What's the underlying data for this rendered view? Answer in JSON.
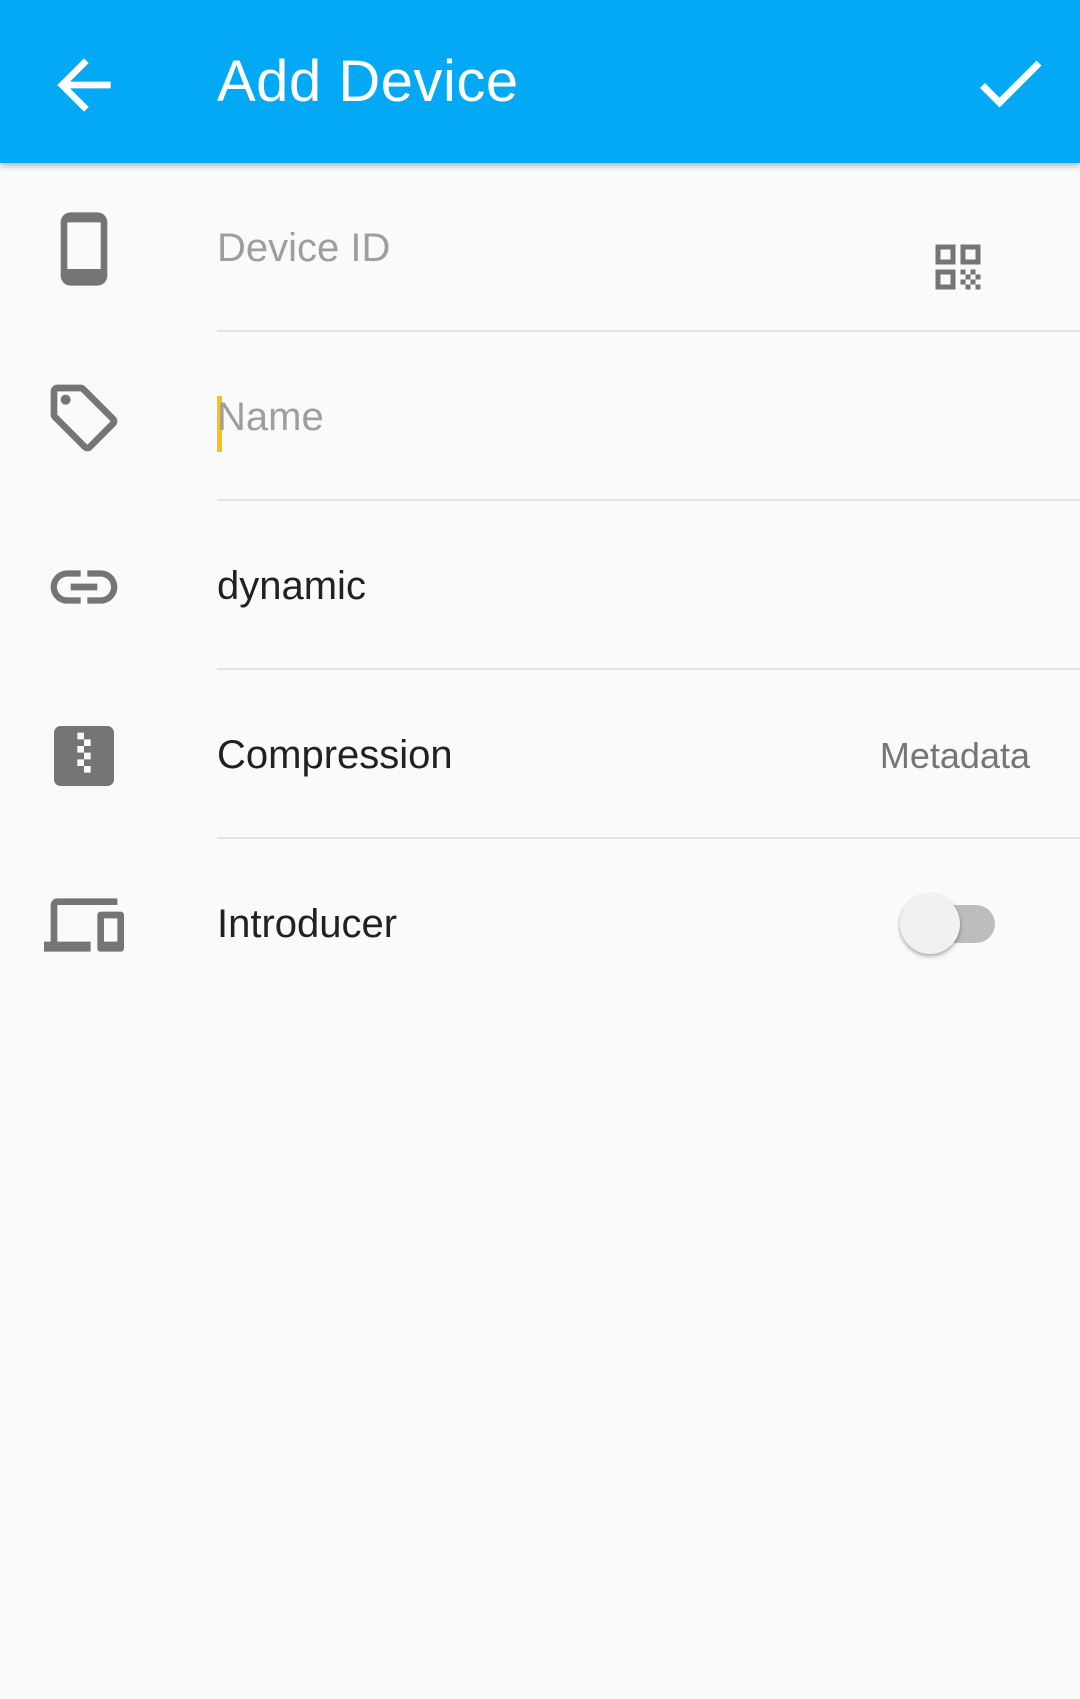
{
  "appbar": {
    "title": "Add Device",
    "back_icon": "arrow-back-icon",
    "confirm_icon": "check-icon",
    "color": "#03a9f4"
  },
  "form": {
    "device_id": {
      "placeholder": "Device ID",
      "icon": "phone-icon",
      "action_icon": "qr-code-icon"
    },
    "name": {
      "placeholder": "Name",
      "icon": "label-icon",
      "cursor_color": "#ffc107"
    },
    "addresses": {
      "value": "dynamic",
      "icon": "link-icon"
    },
    "compression": {
      "label": "Compression",
      "value": "Metadata",
      "icon": "archive-icon"
    },
    "introducer": {
      "label": "Introducer",
      "enabled": false,
      "icon": "devices-icon"
    }
  }
}
